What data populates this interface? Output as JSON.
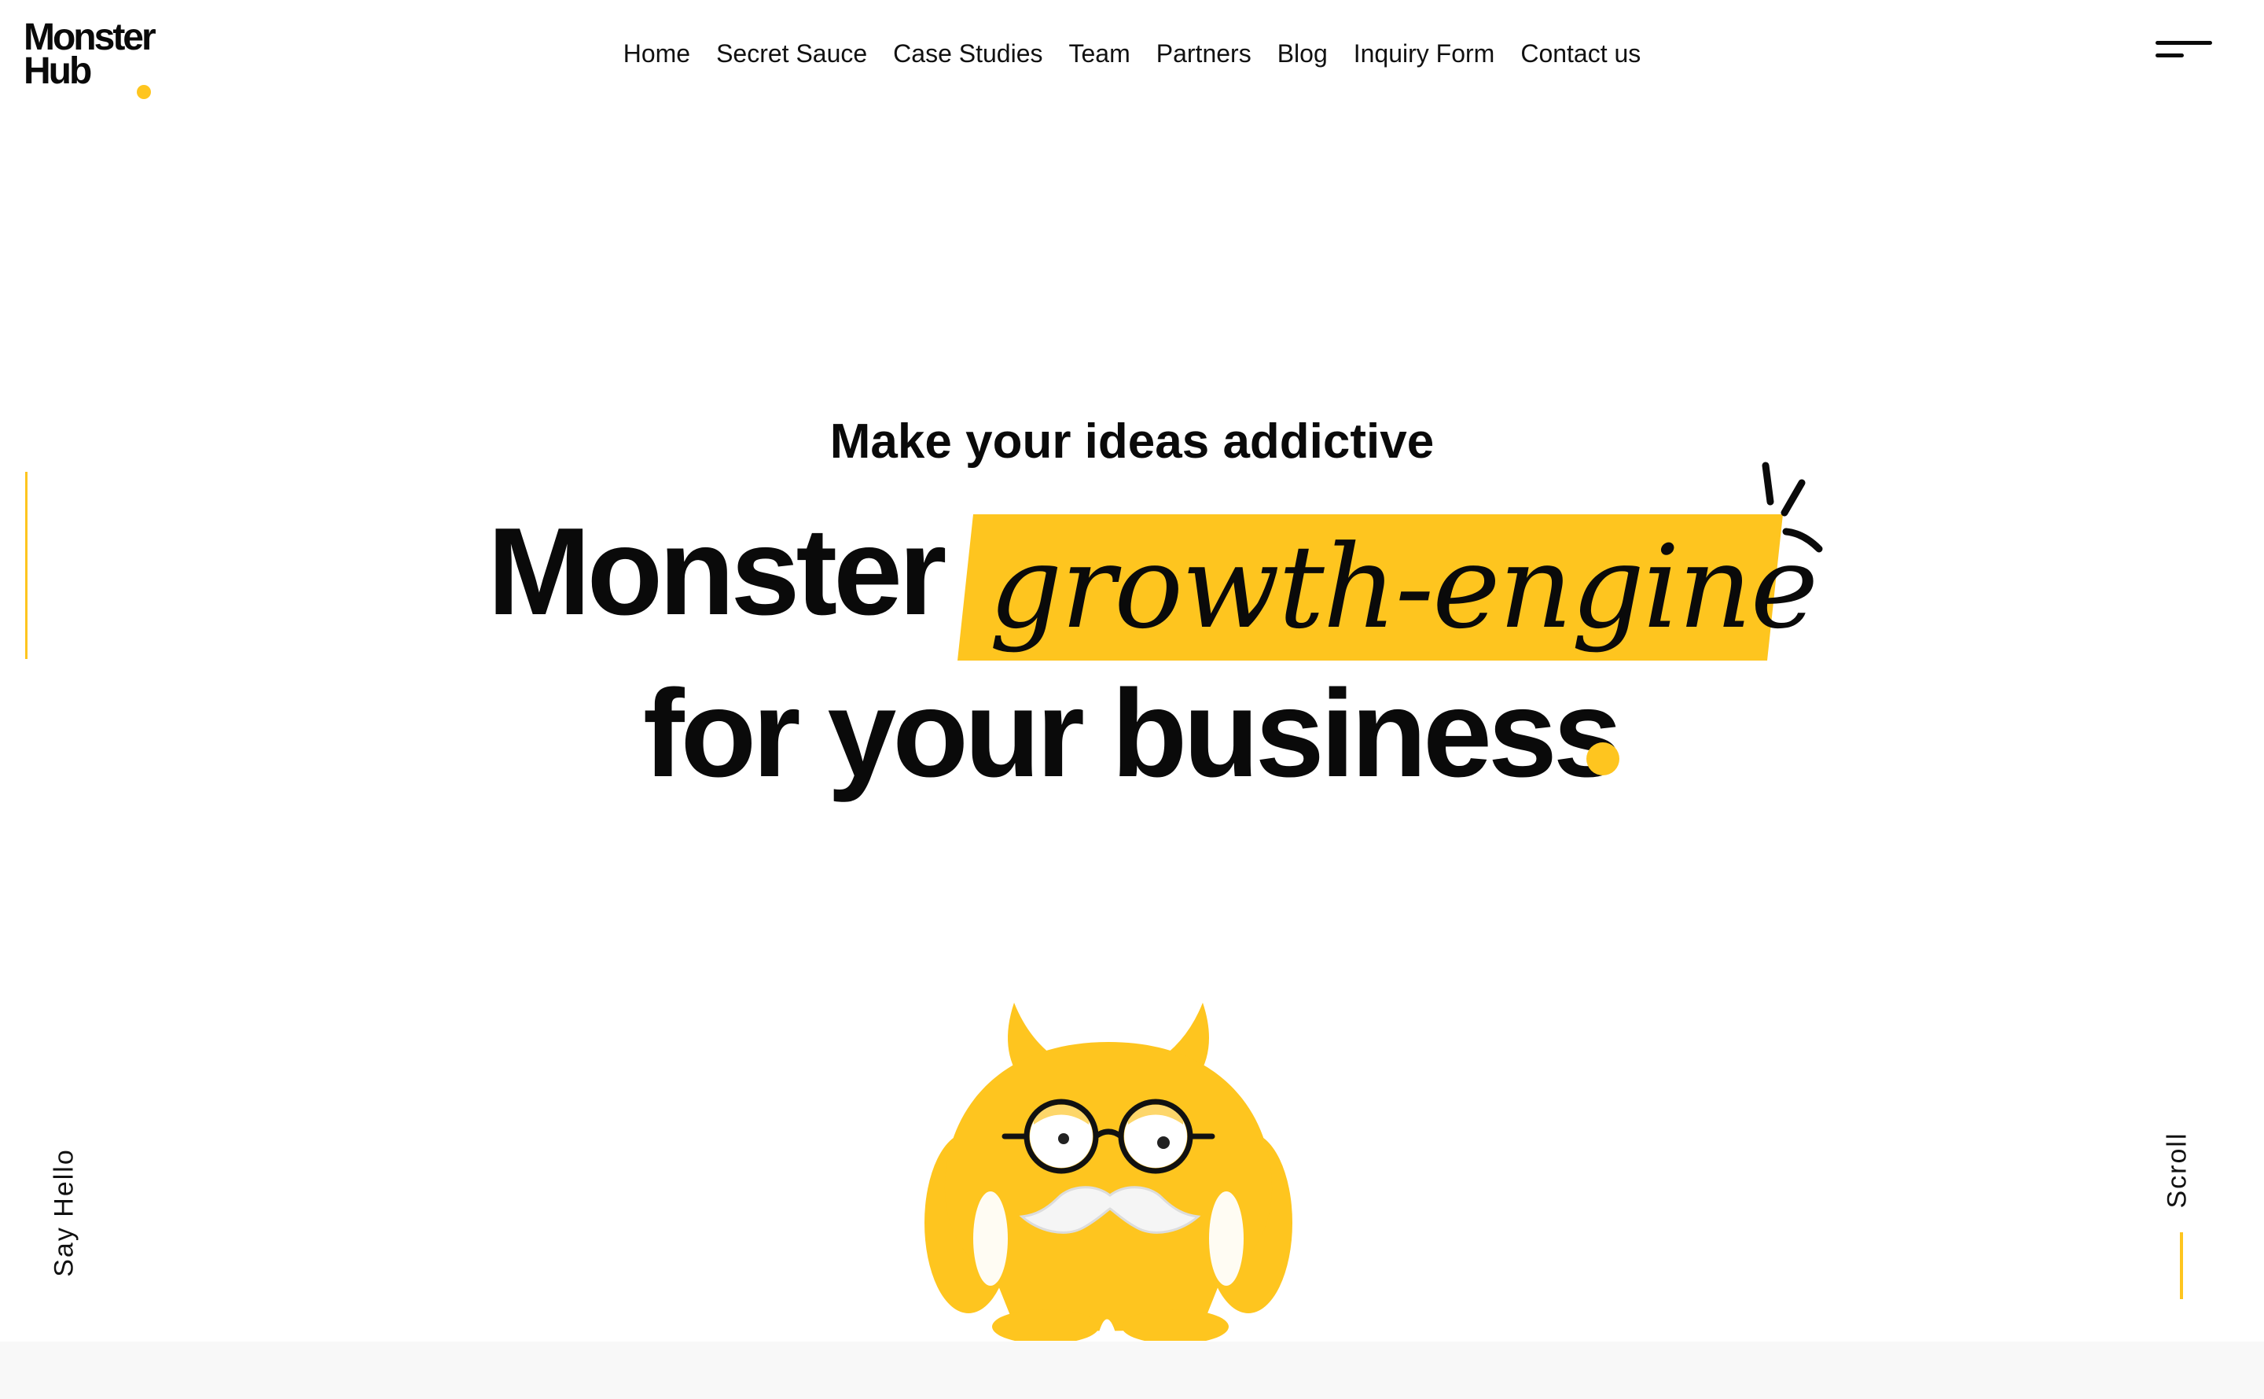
{
  "brand": {
    "logo_line1": "Monster",
    "logo_line2": "Hub",
    "accent_color": "#fec51f"
  },
  "nav": {
    "items": [
      {
        "label": "Home"
      },
      {
        "label": "Secret Sauce"
      },
      {
        "label": "Case Studies"
      },
      {
        "label": "Team"
      },
      {
        "label": "Partners"
      },
      {
        "label": "Blog"
      },
      {
        "label": "Inquiry Form"
      },
      {
        "label": "Contact us"
      }
    ],
    "menu_icon": "hamburger-menu-icon"
  },
  "hero": {
    "tagline": "Make your ideas addictive",
    "headline_word": "Monster",
    "highlight_text": "growth-engine",
    "headline_line2": "for your business"
  },
  "side": {
    "say_hello": "Say Hello",
    "scroll": "Scroll"
  },
  "mascot": {
    "icon": "monster-mascot",
    "body_color": "#fec51f"
  }
}
